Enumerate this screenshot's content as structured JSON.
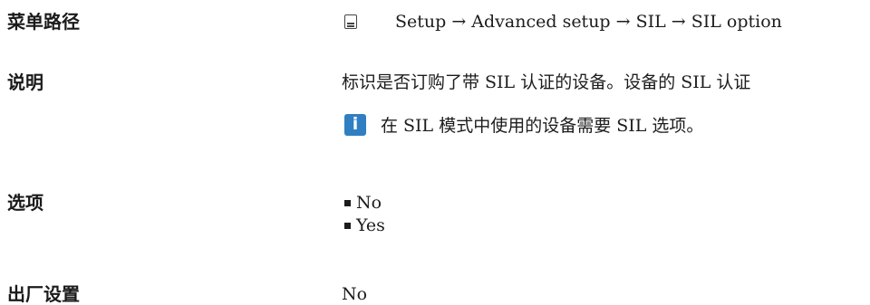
{
  "menu_path": {
    "label": "菜单路径",
    "icon": "display-module-icon",
    "path": "Setup → Advanced setup → SIL → SIL option"
  },
  "description": {
    "label": "说明",
    "text": "标识是否订购了带 SIL 认证的设备。设备的 SIL 认证",
    "note_icon": "info-icon",
    "note": "在 SIL 模式中使用的设备需要 SIL 选项。"
  },
  "options": {
    "label": "选项",
    "items": [
      "No",
      "Yes"
    ]
  },
  "factory_setting": {
    "label": "出厂设置",
    "value": "No"
  },
  "colors": {
    "info_icon": "#2f7fc2",
    "text": "#1c1c1c"
  }
}
